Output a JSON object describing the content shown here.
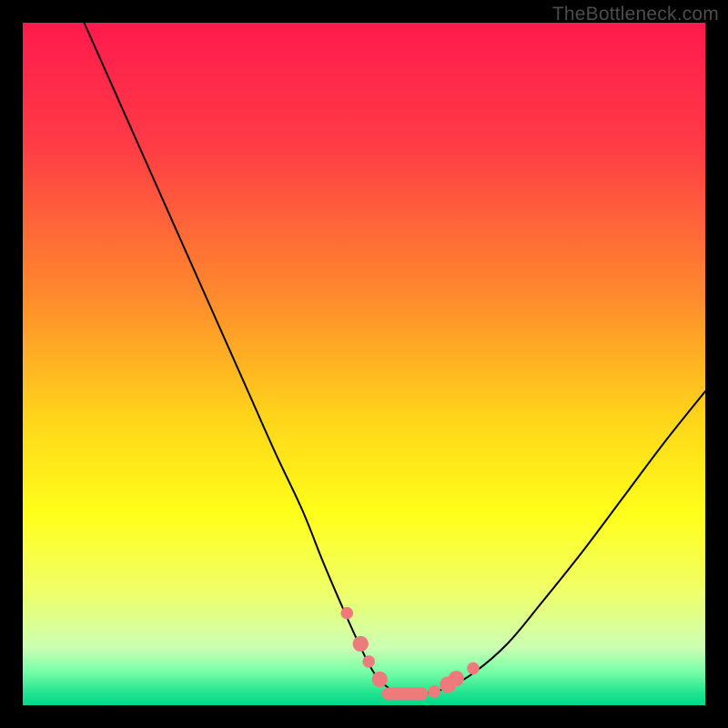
{
  "watermark": "TheBottleneck.com",
  "chart_data": {
    "type": "line",
    "title": "",
    "xlabel": "",
    "ylabel": "",
    "xlim": [
      0,
      100
    ],
    "ylim": [
      0,
      100
    ],
    "grid": false,
    "legend": false,
    "gradient_stops": [
      {
        "t": 0.0,
        "color": "#ff1a4d"
      },
      {
        "t": 0.18,
        "color": "#ff3c46"
      },
      {
        "t": 0.4,
        "color": "#ff8a2d"
      },
      {
        "t": 0.58,
        "color": "#ffd51a"
      },
      {
        "t": 0.72,
        "color": "#ffff1a"
      },
      {
        "t": 0.83,
        "color": "#f0ff66"
      },
      {
        "t": 0.915,
        "color": "#ccffb2"
      },
      {
        "t": 0.95,
        "color": "#7affa8"
      },
      {
        "t": 0.982,
        "color": "#22e38f"
      },
      {
        "t": 1.0,
        "color": "#00d98c"
      }
    ],
    "series": [
      {
        "name": "bottleneck-curve",
        "color": "#000000",
        "x": [
          9,
          13,
          17,
          21,
          25,
          29,
          33,
          37,
          41,
          44,
          47,
          49.5,
          51.5,
          53.5,
          55.5,
          58.5,
          62,
          66,
          71,
          76,
          82,
          88,
          94,
          100
        ],
        "y": [
          100,
          91,
          82,
          73,
          64,
          55,
          46,
          37,
          28.5,
          21,
          14,
          8.5,
          4.7,
          2.6,
          1.7,
          1.7,
          2.5,
          4.7,
          9,
          15,
          22.5,
          30.5,
          38.5,
          46
        ]
      }
    ],
    "markers": [
      {
        "name": "highlight-dots",
        "color": "#ed7b7b",
        "points": [
          {
            "x": 47.5,
            "y": 13.5,
            "r": 0.9
          },
          {
            "x": 49.5,
            "y": 9.0,
            "r": 1.15
          },
          {
            "x": 50.7,
            "y": 6.4,
            "r": 0.9
          },
          {
            "x": 52.3,
            "y": 3.8,
            "r": 1.15
          },
          {
            "x": 60.3,
            "y": 2.0,
            "r": 0.9
          },
          {
            "x": 62.3,
            "y": 3.0,
            "r": 1.2
          },
          {
            "x": 63.5,
            "y": 3.9,
            "r": 1.15
          },
          {
            "x": 66.0,
            "y": 5.4,
            "r": 0.9
          }
        ],
        "segment": {
          "y": 1.7,
          "x0": 53.5,
          "x1": 58.5,
          "thickness": 1.8
        }
      }
    ]
  }
}
